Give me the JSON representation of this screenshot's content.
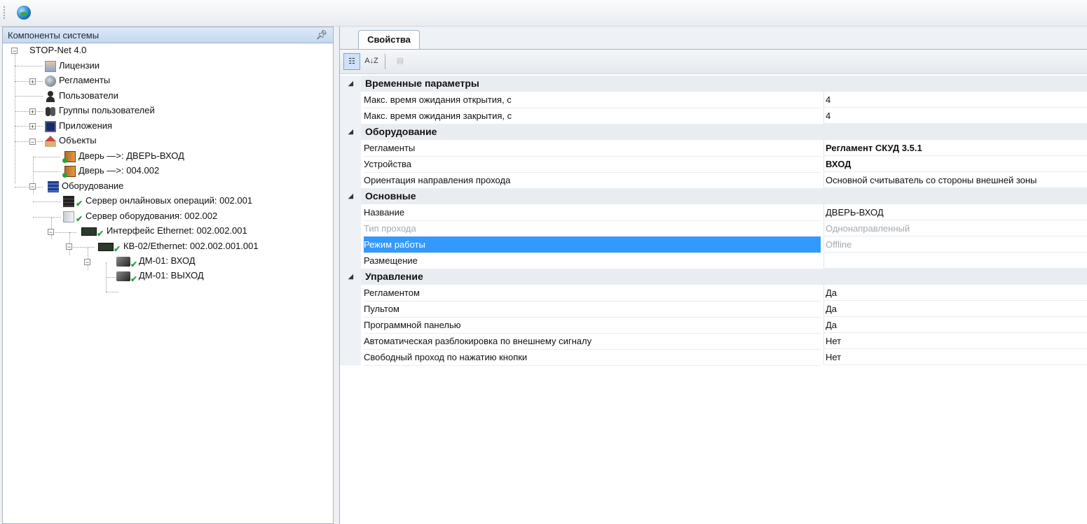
{
  "toolbar": {
    "icon": "globe-icon"
  },
  "left_panel": {
    "title": "Компоненты системы",
    "pin": "ᵖ",
    "tree": {
      "root": "STOP-Net 4.0",
      "licenses": "Лицензии",
      "reglaments": "Регламенты",
      "users": "Пользователи",
      "user_groups": "Группы пользователей",
      "applications": "Приложения",
      "objects": "Объекты",
      "door1": "Дверь  —>: ДВЕРЬ-ВХОД",
      "door2": "Дверь  —>: 004.002",
      "equipment": "Оборудование",
      "online_server": "Сервер онлайновых операций: 002.001",
      "equipment_server": "Сервер оборудования: 002.002",
      "ethernet_iface": "Интерфейс Ethernet: 002.002.001",
      "kb02": "КВ-02/Ethernet: 002.002.001.001",
      "dm_in": "ДМ-01: ВХОД",
      "dm_out": "ДМ-01: ВЫХОД"
    }
  },
  "right_panel": {
    "tab_label": "Свойства",
    "toolbar": {
      "categorized": "categorized-icon",
      "sort_az": "А↓Z",
      "pages": "property-pages-icon"
    },
    "categories": [
      {
        "name": "Временные параметры",
        "props": [
          {
            "name": "Макс. время ожидания открытия, с",
            "value": "4"
          },
          {
            "name": "Макс. время ожидания закрытия, с",
            "value": "4"
          }
        ]
      },
      {
        "name": "Оборудование",
        "props": [
          {
            "name": "Регламенты",
            "value": "Регламент СКУД 3.5.1"
          },
          {
            "name": "Устройства",
            "value": "ВХОД"
          },
          {
            "name": "Ориентация направления прохода",
            "value": "Основной считыватель со стороны внешней зоны"
          }
        ]
      },
      {
        "name": "Основные",
        "props": [
          {
            "name": "Название",
            "value": "ДВЕРЬ-ВХОД"
          },
          {
            "name": "Тип прохода",
            "value": "Однонаправленный"
          },
          {
            "name": "Режим работы",
            "value": "Offline"
          },
          {
            "name": "Размещение",
            "value": ""
          }
        ]
      },
      {
        "name": "Управление",
        "props": [
          {
            "name": "Регламентом",
            "value": "Да"
          },
          {
            "name": "Пультом",
            "value": "Да"
          },
          {
            "name": "Программной панелью",
            "value": "Да"
          },
          {
            "name": "Автоматическая разблокировка по внешнему сигналу",
            "value": "Нет"
          },
          {
            "name": "Свободный проход по нажатию кнопки",
            "value": "Нет"
          }
        ]
      }
    ]
  }
}
